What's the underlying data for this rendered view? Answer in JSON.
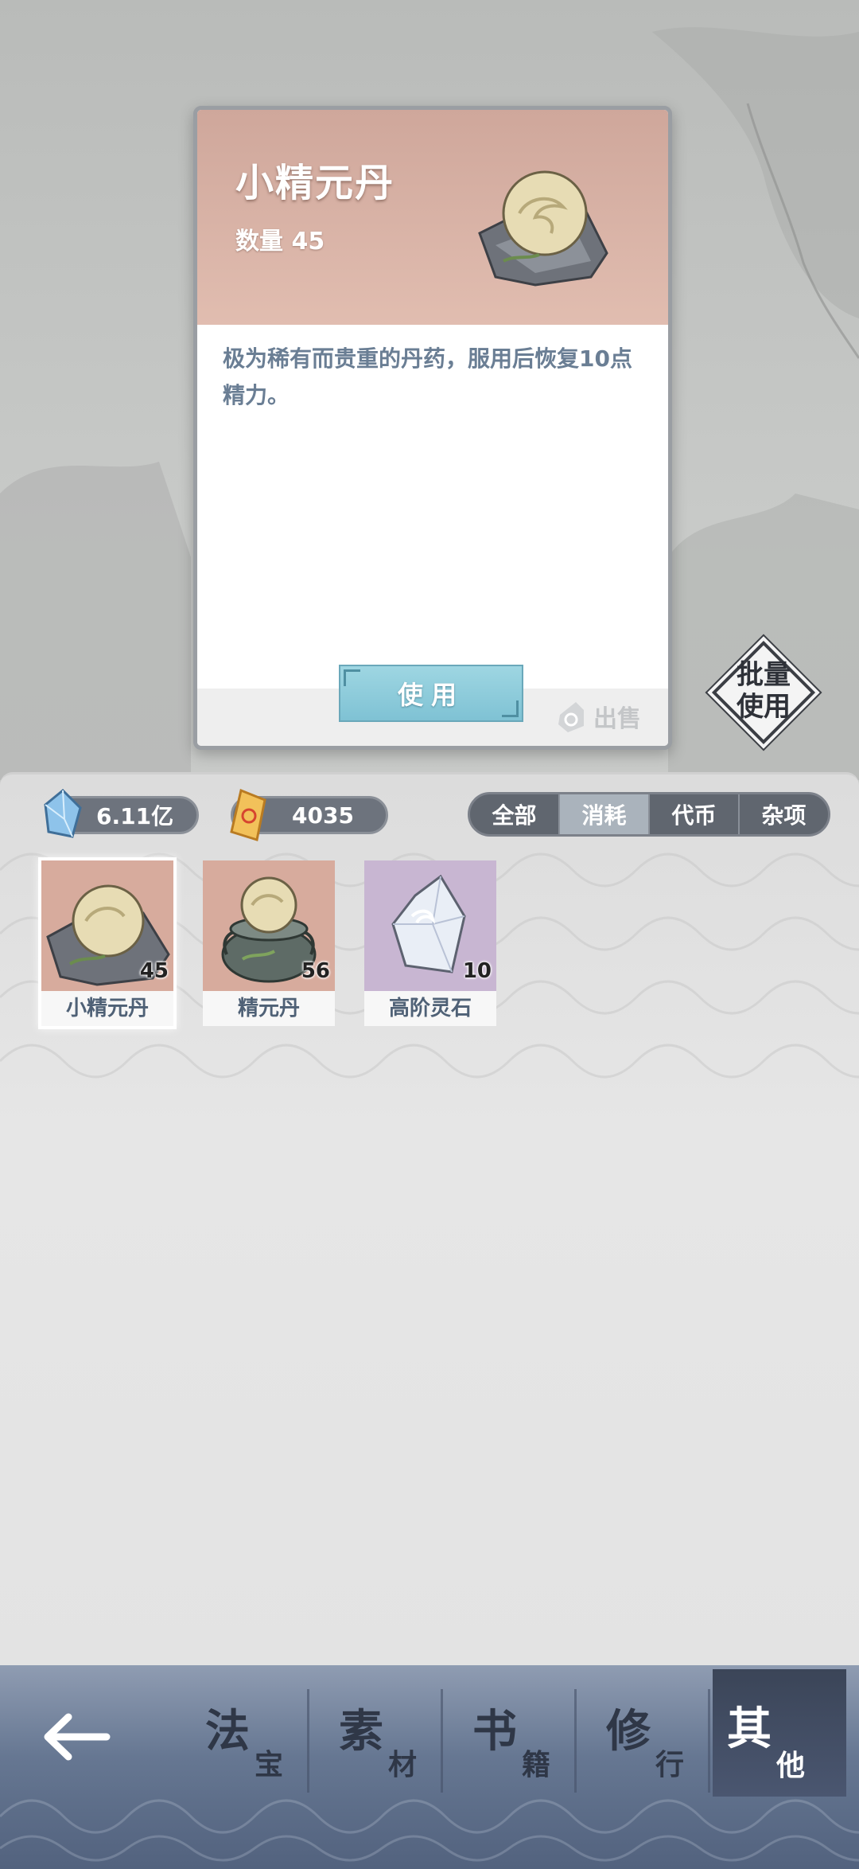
{
  "detail": {
    "name": "小精元丹",
    "quantity_label": "数量",
    "quantity": "45",
    "description": "极为稀有而贵重的丹药，服用后恢复10点精力。",
    "use_label": "使用",
    "sell_label": "出售"
  },
  "batch": {
    "line1": "批量",
    "line2": "使用"
  },
  "currencies": [
    {
      "icon": "blue-crystal-icon",
      "value": "6.11亿"
    },
    {
      "icon": "orange-talisman-icon",
      "value": "4035"
    }
  ],
  "filters": [
    {
      "label": "全部",
      "active": false
    },
    {
      "label": "消耗",
      "active": true
    },
    {
      "label": "代币",
      "active": false
    },
    {
      "label": "杂项",
      "active": false
    }
  ],
  "items": [
    {
      "name": "小精元丹",
      "count": "45",
      "selected": true
    },
    {
      "name": "精元丹",
      "count": "56",
      "selected": false
    },
    {
      "name": "高阶灵石",
      "count": "10",
      "selected": false
    }
  ],
  "nav": {
    "tabs": [
      {
        "big": "法",
        "small": "宝"
      },
      {
        "big": "素",
        "small": "材"
      },
      {
        "big": "书",
        "small": "籍"
      },
      {
        "big": "修",
        "small": "行"
      },
      {
        "big": "其",
        "small": "他"
      }
    ],
    "active_index": 4
  },
  "colors": {
    "card_header": "#d8b1a4",
    "accent_button": "#8fcad9",
    "nav_bg": "#6a7a94"
  }
}
